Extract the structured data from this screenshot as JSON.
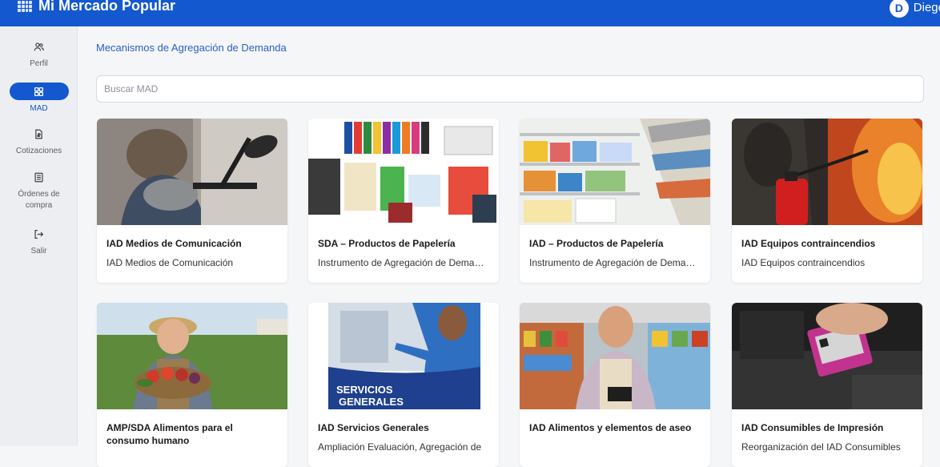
{
  "app": {
    "title": "Mi Mercado Popular",
    "user_initial": "D",
    "user_name": "Diego"
  },
  "colors": {
    "primary": "#1458cf",
    "sidebar_bg": "#eceef1",
    "page_bg": "#f5f6f8"
  },
  "sidebar": {
    "items": [
      {
        "label": "Perfil",
        "icon": "users-icon"
      },
      {
        "label": "MAD",
        "icon": "grid-icon",
        "active": true
      },
      {
        "label": "Cotizaciones",
        "icon": "document-icon"
      },
      {
        "label": "Órdenes de compra",
        "icon": "list-icon"
      },
      {
        "label": "Salir",
        "icon": "logout-icon"
      }
    ]
  },
  "main": {
    "title": "Mecanismos de Agregación de Demanda",
    "search_placeholder": "Buscar MAD",
    "cards": [
      {
        "title": "IAD Medios de Comunicación",
        "subtitle": "IAD Medios de Comunicación",
        "image": "microphone-studio"
      },
      {
        "title": "SDA – Productos de Papelería",
        "subtitle": "Instrumento de Agregación de Demanda",
        "image": "office-supplies"
      },
      {
        "title": "IAD – Productos de Papelería",
        "subtitle": "Instrumento de Agregación de Demanda",
        "image": "store-shelves"
      },
      {
        "title": "IAD Equipos contraincendios",
        "subtitle": "IAD Equipos contraincendios",
        "image": "fire-extinguisher"
      },
      {
        "title": "AMP/SDA Alimentos para el consumo humano",
        "subtitle": "",
        "image": "farmer-vegetables"
      },
      {
        "title": "IAD Servicios Generales",
        "subtitle": "Ampliación Evaluación, Agregación de",
        "image": "servicios-generales",
        "image_text": "SERVICIOS GENERALES"
      },
      {
        "title": "IAD Alimentos y elementos de aseo",
        "subtitle": "",
        "image": "grocery-shopkeeper"
      },
      {
        "title": "IAD Consumibles de Impresión",
        "subtitle": "Reorganización del IAD Consumibles",
        "image": "printer-cartridge"
      }
    ]
  }
}
